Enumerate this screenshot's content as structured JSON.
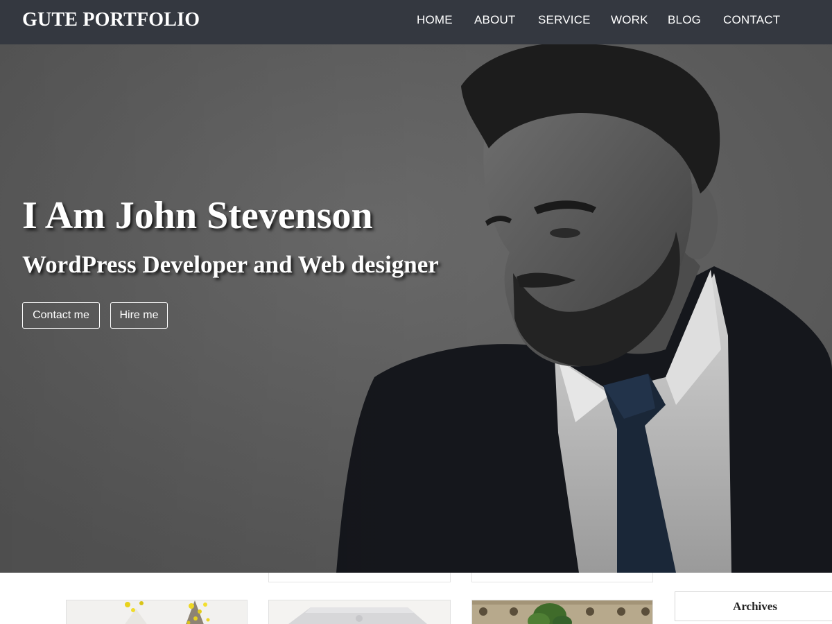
{
  "site": {
    "brand": "GUTE PORTFOLIO"
  },
  "nav": {
    "items": [
      {
        "label": "HOME"
      },
      {
        "label": "ABOUT"
      },
      {
        "label": "SERVICE"
      },
      {
        "label": "WORK"
      },
      {
        "label": "BLOG"
      },
      {
        "label": "CONTACT"
      }
    ]
  },
  "hero": {
    "title": "I Am John Stevenson",
    "subtitle": "WordPress Developer and Web designer",
    "buttons": [
      {
        "label": "Contact me"
      },
      {
        "label": "Hire me"
      }
    ]
  },
  "sidebar": {
    "archives_title": "Archives"
  },
  "colors": {
    "navbar_bg": "#343840",
    "hero_bg": "#5c5c5c",
    "text_light": "#ffffff"
  }
}
